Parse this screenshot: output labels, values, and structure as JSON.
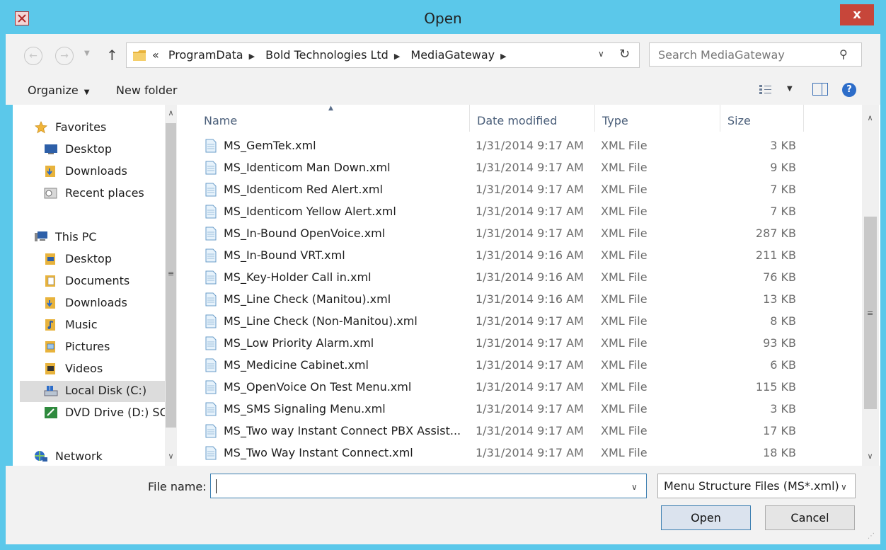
{
  "window": {
    "title": "Open",
    "close_glyph": "x"
  },
  "navbar": {
    "back_glyph": "←",
    "forward_glyph": "→",
    "up_glyph": "↑",
    "breadcrumb_prefix": "«",
    "breadcrumb": [
      "ProgramData",
      "Bold Technologies Ltd",
      "MediaGateway"
    ],
    "breadcrumb_sep": "▶",
    "search_placeholder": "Search MediaGateway"
  },
  "toolbar": {
    "organize_label": "Organize",
    "new_folder_label": "New folder",
    "help_glyph": "?"
  },
  "nav_pane": {
    "items": [
      {
        "label": "Favorites",
        "icon": "star-icon"
      },
      {
        "label": "Desktop",
        "icon": "desktop-icon"
      },
      {
        "label": "Downloads",
        "icon": "downloads-folder-icon"
      },
      {
        "label": "Recent places",
        "icon": "recent-places-icon"
      },
      {
        "label": "This PC",
        "icon": "computer-icon"
      },
      {
        "label": "Desktop",
        "icon": "desktop-folder-icon"
      },
      {
        "label": "Documents",
        "icon": "documents-folder-icon"
      },
      {
        "label": "Downloads",
        "icon": "downloads-folder-icon"
      },
      {
        "label": "Music",
        "icon": "music-folder-icon"
      },
      {
        "label": "Pictures",
        "icon": "pictures-folder-icon"
      },
      {
        "label": "Videos",
        "icon": "videos-folder-icon"
      },
      {
        "label": "Local Disk (C:)",
        "icon": "local-disk-icon"
      },
      {
        "label": "DVD Drive (D:) SC",
        "icon": "dvd-drive-icon"
      },
      {
        "label": "Network",
        "icon": "network-icon"
      }
    ]
  },
  "file_list": {
    "columns": {
      "name": "Name",
      "date": "Date modified",
      "type": "Type",
      "size": "Size"
    },
    "rows": [
      {
        "name": "MS_GemTek.xml",
        "date": "1/31/2014 9:17 AM",
        "type": "XML File",
        "size": "3 KB"
      },
      {
        "name": "MS_Identicom Man Down.xml",
        "date": "1/31/2014 9:17 AM",
        "type": "XML File",
        "size": "9 KB"
      },
      {
        "name": "MS_Identicom Red Alert.xml",
        "date": "1/31/2014 9:17 AM",
        "type": "XML File",
        "size": "7 KB"
      },
      {
        "name": "MS_Identicom Yellow Alert.xml",
        "date": "1/31/2014 9:17 AM",
        "type": "XML File",
        "size": "7 KB"
      },
      {
        "name": "MS_In-Bound OpenVoice.xml",
        "date": "1/31/2014 9:17 AM",
        "type": "XML File",
        "size": "287 KB"
      },
      {
        "name": "MS_In-Bound VRT.xml",
        "date": "1/31/2014 9:16 AM",
        "type": "XML File",
        "size": "211 KB"
      },
      {
        "name": "MS_Key-Holder Call in.xml",
        "date": "1/31/2014 9:16 AM",
        "type": "XML File",
        "size": "76 KB"
      },
      {
        "name": "MS_Line Check (Manitou).xml",
        "date": "1/31/2014 9:16 AM",
        "type": "XML File",
        "size": "13 KB"
      },
      {
        "name": "MS_Line Check (Non-Manitou).xml",
        "date": "1/31/2014 9:17 AM",
        "type": "XML File",
        "size": "8 KB"
      },
      {
        "name": "MS_Low Priority Alarm.xml",
        "date": "1/31/2014 9:17 AM",
        "type": "XML File",
        "size": "93 KB"
      },
      {
        "name": "MS_Medicine Cabinet.xml",
        "date": "1/31/2014 9:17 AM",
        "type": "XML File",
        "size": "6 KB"
      },
      {
        "name": "MS_OpenVoice On Test Menu.xml",
        "date": "1/31/2014 9:17 AM",
        "type": "XML File",
        "size": "115 KB"
      },
      {
        "name": "MS_SMS Signaling Menu.xml",
        "date": "1/31/2014 9:17 AM",
        "type": "XML File",
        "size": "3 KB"
      },
      {
        "name": "MS_Two way Instant Connect PBX Assist...",
        "date": "1/31/2014 9:17 AM",
        "type": "XML File",
        "size": "17 KB"
      },
      {
        "name": "MS_Two Way Instant Connect.xml",
        "date": "1/31/2014 9:17 AM",
        "type": "XML File",
        "size": "18 KB"
      }
    ]
  },
  "footer": {
    "file_name_label": "File name:",
    "file_name_value": "",
    "filter_value": "Menu Structure Files (MS*.xml)",
    "open_label": "Open",
    "cancel_label": "Cancel"
  },
  "colors": {
    "frame": "#5bc8ea",
    "close": "#c7463a",
    "header_text": "#4b5f7a"
  }
}
